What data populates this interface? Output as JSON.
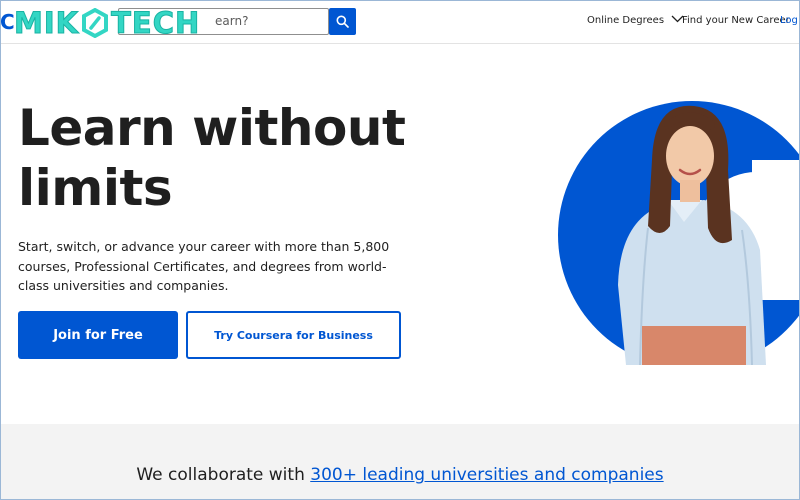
{
  "header": {
    "logo_fragment": "C",
    "search": {
      "placeholder": "What do you want to learn?",
      "visible_text": "earn?"
    },
    "nav": [
      {
        "label": "Online Degrees"
      },
      {
        "label": "Find your New Career"
      },
      {
        "label": "Log In"
      }
    ]
  },
  "watermark": {
    "text_left": "MIK",
    "text_right": "TECH"
  },
  "hero": {
    "title": "Learn without limits",
    "subtitle": "Start, switch, or advance your career with more than 5,800 courses, Professional Certificates, and degrees from world-class universities and companies.",
    "primary_button": "Join for Free",
    "secondary_button": "Try Coursera for Business"
  },
  "collaborate": {
    "prefix": "We collaborate with ",
    "link": "300+ leading universities and companies"
  },
  "colors": {
    "brand_blue": "#0056d2",
    "watermark": "#33d6c4",
    "band_gray": "#f3f3f3"
  },
  "icons": [
    "search-icon",
    "chevron-down-icon",
    "watermark-hex-icon"
  ]
}
